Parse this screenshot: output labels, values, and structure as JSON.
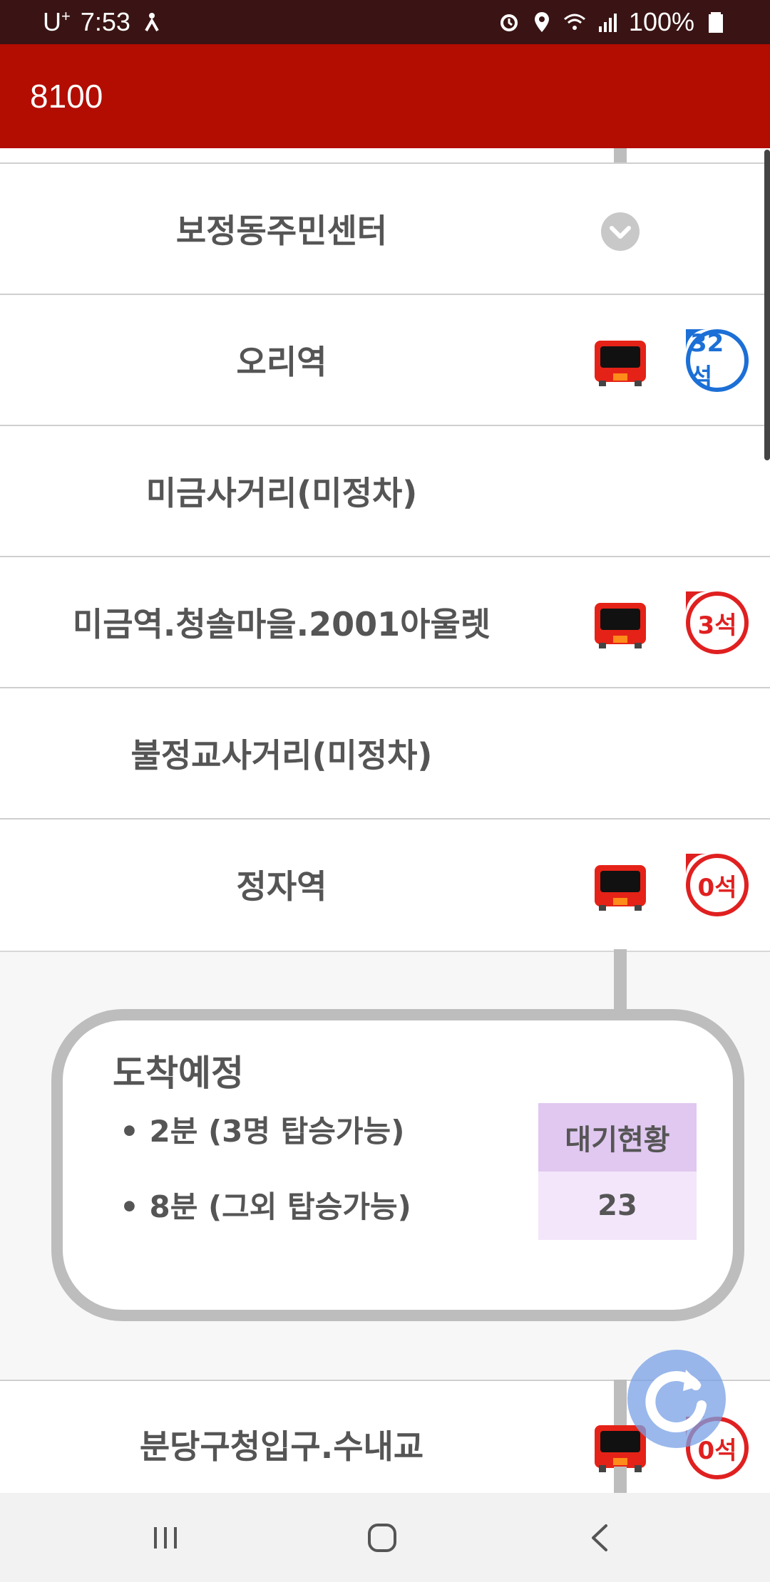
{
  "status_bar": {
    "carrier": "U",
    "carrier_sup": "+",
    "time": "7:53",
    "battery": "100%"
  },
  "app_bar": {
    "title": "8100"
  },
  "stops": [
    {
      "name": "보정동주민센터",
      "bus": false,
      "seat": null
    },
    {
      "name": "오리역",
      "bus": true,
      "seat": "32석",
      "seat_color": "blue"
    },
    {
      "name": "미금사거리(미정차)",
      "bus": false,
      "seat": null
    },
    {
      "name": "미금역.청솔마을.2001아울렛",
      "bus": true,
      "seat": "3석",
      "seat_color": "red"
    },
    {
      "name": "불정교사거리(미정차)",
      "bus": false,
      "seat": null
    },
    {
      "name": "정자역",
      "bus": true,
      "seat": "0석",
      "seat_color": "red"
    },
    {
      "name": "분당구청입구.수내교",
      "bus": true,
      "seat": "0석",
      "seat_color": "red"
    }
  ],
  "arrival": {
    "title": "도착예정",
    "line1": "• 2분 (3명 탑승가능)",
    "line2": "• 8분 (그외 탑승가능)",
    "wait_label": "대기현황",
    "wait_value": "23"
  },
  "colors": {
    "app_bar": "#b30c00",
    "status_bar": "#3a1414",
    "seat_blue": "#1c6fd6",
    "seat_red": "#e02020",
    "wait_header": "#e0c8f0",
    "wait_value_bg": "#f3e6fb"
  },
  "icons": {
    "chevron": "chevron-down-icon",
    "bus": "bus-icon",
    "refresh": "refresh-icon",
    "nav_recents": "recent-apps-icon",
    "nav_home": "home-icon",
    "nav_back": "back-icon"
  }
}
